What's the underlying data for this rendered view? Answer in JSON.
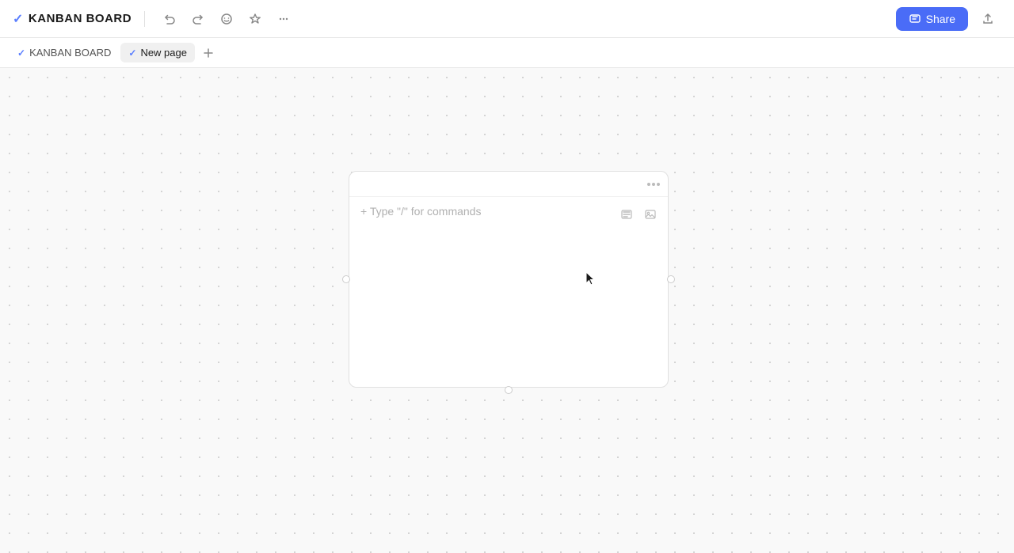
{
  "header": {
    "title": "KANBAN BOARD",
    "check_symbol": "✓",
    "undo_label": "↺",
    "redo_label": "↻",
    "emoji_icon": "☺",
    "star_icon": "☆",
    "more_icon": "⋯",
    "share_label": "Share",
    "export_icon": "⬆"
  },
  "tabs": [
    {
      "id": "kanban-board",
      "label": "KANBAN BOARD",
      "active": false
    },
    {
      "id": "new-page",
      "label": "New page",
      "active": true
    }
  ],
  "add_tab_label": "+",
  "canvas": {
    "card": {
      "menu_dots": [
        "•",
        "•",
        "•"
      ],
      "placeholder": "+ Type \"/\" for commands",
      "action_list_icon": "≡",
      "action_image_icon": "⊡"
    }
  }
}
